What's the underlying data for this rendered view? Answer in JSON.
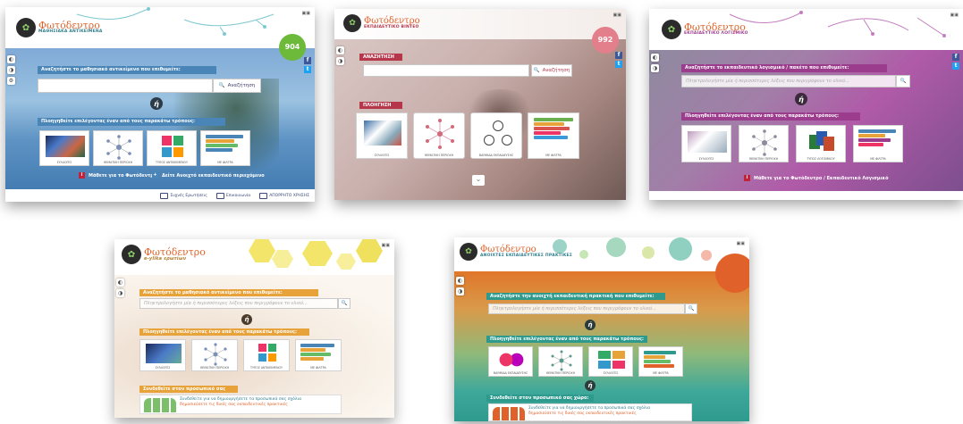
{
  "brand": {
    "name": "Φωτόδεντρο",
    "logo_glyph": "✿",
    "subtitles": {
      "edu_materials": "ΜΑΘΗΣΙΑΚΑ ΑΝΤΙΚΕΙΜΕΝΑ",
      "video": "ΕΚΠΑΙΔΕΥΤΙΚΟ ΒΙΝΤΕΟ",
      "software": "ΕΚΠΑΙΔΕΥΤΙΚΟ ΛΟΓΙΣΜΙΚΟ",
      "ebooks": "e-ylika ερωτίων",
      "open_practices": "ΑΝΟΙΧΤΕΣ ΕΚΠΑΙΔΕΥΤΙΚΕΣ ΠΡΑΚΤΙΚΕΣ"
    }
  },
  "common": {
    "eta_glyph": "ή",
    "search_label": "Αναζήτηση",
    "search_glyph": "🔍",
    "search_placeholder": "Πληκτρολογήστε μία ή περισσότερες λέξεις που περιγράφουν το υλικό...",
    "browse_prompt": "Πλοηγηθείτε επιλέγοντας έναν από τους παρακάτω τρόπους:",
    "connect_prompt": "Συνδεθείτε στον προσωπικό σας χώρο:",
    "connect_text_1": "Συνδεθείτε για να δημιουργήσετε τα προσωπικά σας σχόλια",
    "connect_text_2": "δημοσιεύσετε τις δικές σας εκπαιδευτικές πρακτικές",
    "tiles": {
      "collections": "ΣΥΛΛΟΓΕΣ",
      "thematic": "ΘΕΜΑΤΙΚΗ ΠΕΡΙΟΧΗ",
      "types": "ΤΥΠΟΣ ΑΝΤΙΚΕΙΜΕΝΟΥ",
      "filters": "ΜΕ ΦΙΛΤΡΑ",
      "edu_levels": "ΒΑΘΜΙΔΑ ΕΚΠΑΙΔΕΥΣΗΣ",
      "software_type": "ΤΥΠΟΣ ΛΟΓΙΣΜΙΚΟΥ"
    },
    "social": [
      "f",
      "t"
    ]
  },
  "shot1": {
    "search_title": "Αναζητήστε το μαθησιακό αντικείμενο που επιθυμείτε:",
    "badge": "904",
    "learn_more": "Μάθετε για το Φωτόδεντρο",
    "open_content": "Δείτε Ανοιχτό εκπαιδευτικό περιεχόμενο",
    "footer": [
      "Συχνές Ερωτήσεις",
      "Επικοινωνία",
      "ΑΠΟΡΡΗΤΟ ΧΡΗΣΗΣ"
    ]
  },
  "shot2": {
    "search_title": "ΑΝΑΖΗΤΗΣΗ",
    "browse_title": "ΠΛΟΗΓΗΣΗ",
    "badge": "992",
    "chevron": "⌄"
  },
  "shot3": {
    "search_title": "Αναζητήστε το εκπαιδευτικό λογισμικό / πακέτο που επιθυμείτε:",
    "browse_prompt": "Πλοηγηθείτε επιλέγοντας έναν από τους παρακάτω τρόπους:",
    "learn_more": "Μάθετε για το Φωτόδεντρο / Εκπαιδευτικό Λογισμικό"
  },
  "shot4": {
    "search_title": "Αναζητήστε το μαθησιακό αντικείμενο που επιθυμείτε:"
  },
  "shot5": {
    "search_title": "Αναζητήστε την ανοιχτή εκπαιδευτική πρακτική που επιθυμείτε:"
  },
  "colors": {
    "orange": "#e0622a",
    "teal": "#2f7d8e",
    "sea_blue": "#4a85b8",
    "purple": "#9b3c8d",
    "coral": "#d9534f"
  }
}
